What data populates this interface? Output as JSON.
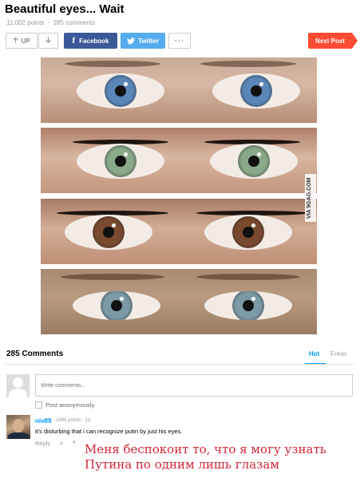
{
  "post": {
    "title": "Beautiful eyes... Wait",
    "points": "11,002 points",
    "separator": "·",
    "comments_count": "285 comments"
  },
  "actions": {
    "up_label": "UP",
    "facebook_label": "Facebook",
    "twitter_label": "Twitter",
    "more_label": "···",
    "next_label": "Next Post"
  },
  "image": {
    "watermark": "VIA 9GAG.COM",
    "strips": [
      {
        "iris_color": "#5b86b8"
      },
      {
        "iris_color": "#8aa88a"
      },
      {
        "iris_color": "#7a4a2e"
      },
      {
        "iris_color": "#7c9aa6"
      }
    ]
  },
  "comments": {
    "title": "285 Comments",
    "tab_hot": "Hot",
    "tab_fresh": "Fresh",
    "input_placeholder": "Write comments...",
    "anonymous_label": "Post anonymously",
    "items": [
      {
        "user": "niv89",
        "points": "1695 points",
        "separator": "·",
        "time": "1d",
        "text": "it's disturbing that i can recognize putin by just his eyes.",
        "reply_label": "Reply"
      }
    ]
  },
  "overlay_text": {
    "line1": "Меня беспокоит то, что я могу узнать",
    "line2": "Путина по одним лишь глазам"
  },
  "colors": {
    "accent": "#0099ff",
    "facebook": "#3b5998",
    "twitter": "#55acee",
    "next_post": "#ff4b33",
    "overlay_text": "#d4263a"
  }
}
